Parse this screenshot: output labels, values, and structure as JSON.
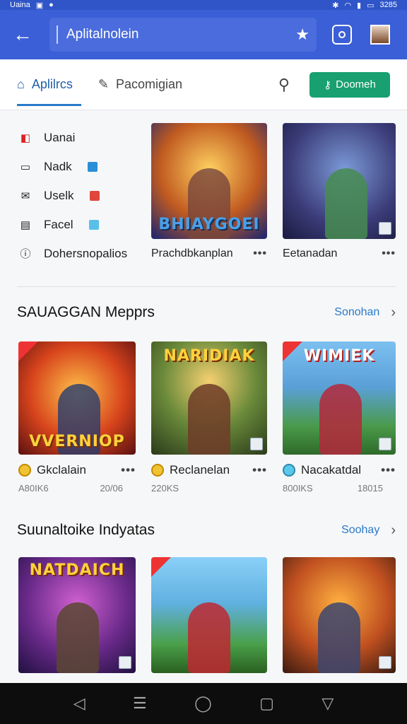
{
  "status": {
    "left1": "Uaina",
    "time": "3285"
  },
  "appbar": {
    "title": "Aplitalnolein"
  },
  "tabs": {
    "tab1": "Aplilrcs",
    "tab2": "Pacomigian",
    "download": "Doomeh"
  },
  "sidemenu": [
    {
      "label": "Uanai",
      "icon": "bag-icon"
    },
    {
      "label": "Nadk",
      "icon": "folder-icon"
    },
    {
      "label": "Uselk",
      "icon": "mail-icon"
    },
    {
      "label": "Facel",
      "icon": "card-icon"
    },
    {
      "label": "Dohersnopalios",
      "icon": "info-icon"
    }
  ],
  "top_cards": [
    {
      "banner": "BHIAYGOEI",
      "title": "Prachdbkanplan"
    },
    {
      "banner": "",
      "title": "Eetanadan"
    }
  ],
  "section1": {
    "heading": "SAUAGGAN Mepprs",
    "link": "Sonohan"
  },
  "row1": [
    {
      "banner": "VVERNIOP",
      "title": "Gkclalain",
      "sub1": "A80IK6",
      "sub2": "20/06"
    },
    {
      "banner": "NARIDIAK",
      "title": "Reclanelan",
      "sub1": "220KS",
      "sub2": ""
    },
    {
      "banner": "WIMIEK",
      "title": "Nacakatdal",
      "sub1": "800IKS",
      "sub2": "18015"
    }
  ],
  "section2": {
    "heading": "Suunaltoike Indyatas",
    "link": "Soohay"
  },
  "row2": [
    {
      "banner": "NATDAICH"
    },
    {
      "banner": ""
    },
    {
      "banner": ""
    }
  ],
  "colors": {
    "appbar": "#3b5fd6",
    "accent": "#2a79c9",
    "download": "#18a070"
  }
}
